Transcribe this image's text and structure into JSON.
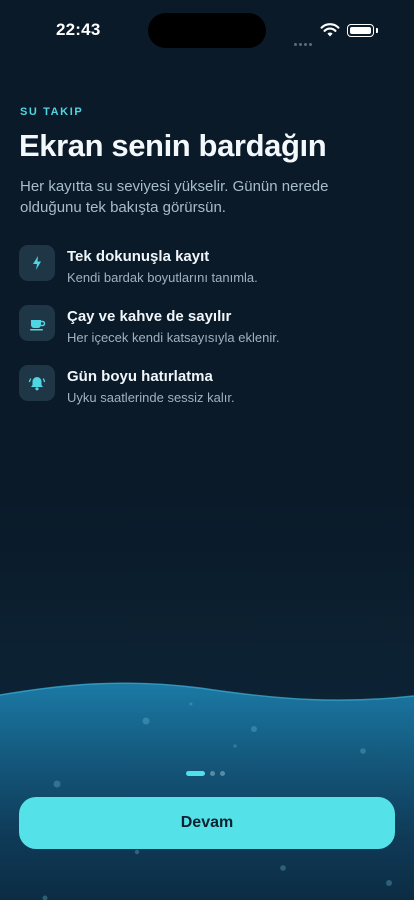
{
  "status": {
    "time": "22:43"
  },
  "header": {
    "eyebrow": "SU TAKIP",
    "title": "Ekran senin bardağın",
    "subtitle": "Her kayıtta su seviyesi yükselir. Günün nerede olduğunu tek bakışta görürsün."
  },
  "features": [
    {
      "icon": "lightning-icon",
      "title": "Tek dokunuşla kayıt",
      "desc": "Kendi bardak boyutlarını tanımla."
    },
    {
      "icon": "cup-icon",
      "title": "Çay ve kahve de sayılır",
      "desc": "Her içecek kendi katsayısıyla eklenir."
    },
    {
      "icon": "bell-icon",
      "title": "Gün boyu hatırlatma",
      "desc": "Uyku saatlerinde sessiz kalır."
    }
  ],
  "pagination": {
    "total": 3,
    "current": 1
  },
  "cta": {
    "label": "Devam"
  },
  "colors": {
    "accent": "#55e1e8",
    "background": "#0b1a28",
    "water": "#1a6f99"
  }
}
